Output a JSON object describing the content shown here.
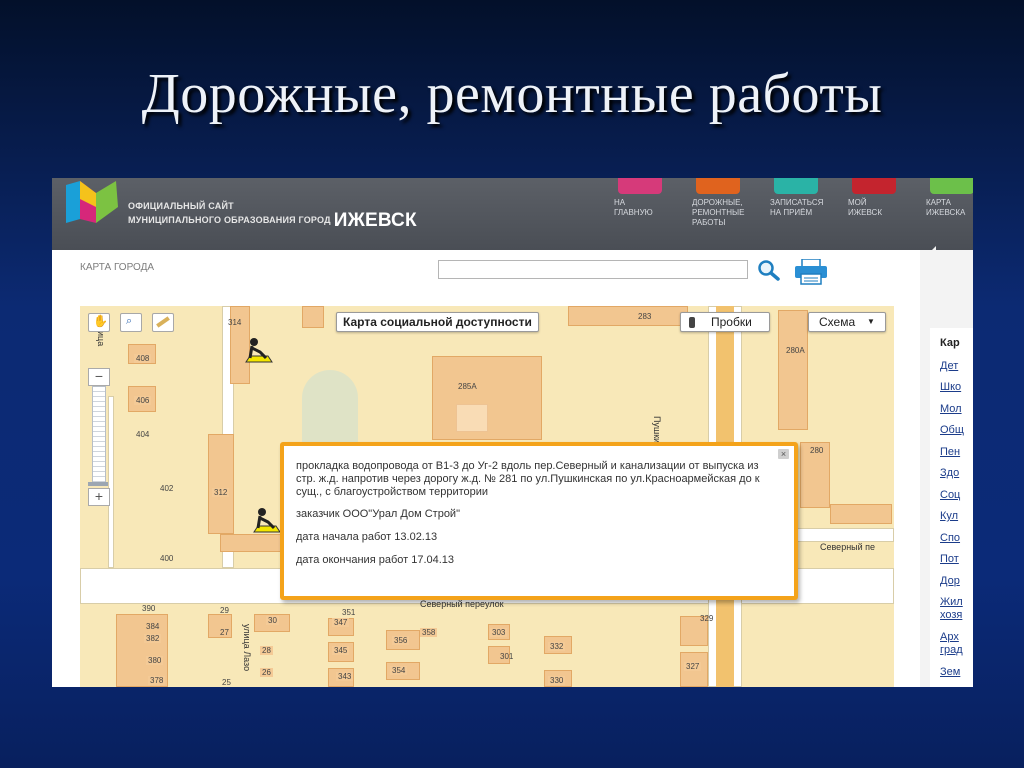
{
  "slide": {
    "title": "Дорожные, ремонтные работы"
  },
  "site": {
    "logo_line1": "ОФИЦИАЛЬНЫЙ САЙТ",
    "logo_line2": "МУНИЦИПАЛЬНОГО ОБРАЗОВАНИЯ ГОРОД",
    "city": "ИЖЕВСК",
    "nav": [
      {
        "line1": "НА",
        "line2": "ГЛАВНУЮ",
        "line3": "",
        "color": "#d63a7a"
      },
      {
        "line1": "ДОРОЖНЫЕ,",
        "line2": "РЕМОНТНЫЕ",
        "line3": "РАБОТЫ",
        "color": "#e0631e"
      },
      {
        "line1": "ЗАПИСАТЬСЯ",
        "line2": "НА ПРИЁМ",
        "line3": "",
        "color": "#2ab3a6"
      },
      {
        "line1": "МОЙ",
        "line2": "ИЖЕВСК",
        "line3": "",
        "color": "#c4242e"
      },
      {
        "line1": "КАРТА",
        "line2": "ИЖЕВСКА",
        "line3": "",
        "color": "#6cc04a"
      }
    ]
  },
  "page": {
    "heading": "КАРТА ГОРОДА",
    "search_value": ""
  },
  "map": {
    "social_button": "Карта социальной доступности",
    "traffic_button": "Пробки",
    "scheme_button": "Схема",
    "scheme_arrow": "▼",
    "zoom_minus": "−",
    "zoom_plus": "+",
    "streets": {
      "pushkinskaya": "Пушкинская ул",
      "severny_per": "Северный переулок",
      "severny_pe": "Северный пе",
      "lazo": "улица Лазо",
      "edge": "рица"
    },
    "house_numbers": [
      "314",
      "283",
      "408",
      "406",
      "404",
      "402",
      "400",
      "285А",
      "280А",
      "280",
      "312",
      "390",
      "384",
      "382",
      "380",
      "378",
      "29",
      "27",
      "25",
      "30",
      "28",
      "26",
      "351",
      "347",
      "345",
      "343",
      "358",
      "356",
      "354",
      "303",
      "301",
      "332",
      "330",
      "327",
      "329"
    ]
  },
  "popup": {
    "description": "прокладка водопровода от В1-3 до Уг-2 вдоль пер.Северный и канализации от выпуска из стр. ж.д. напротив через дорогу ж.д. № 281 по ул.Пушкинская по ул.Красноармейская до к сущ., с благоустройством территории",
    "customer": "заказчик ООО\"Урал Дом Строй\"",
    "start": "дата начала работ 13.02.13",
    "end": "дата окончания работ 17.04.13",
    "close": "×"
  },
  "sidebar": {
    "heading": "Кар",
    "links": [
      "Дет",
      "Шко",
      "Мол",
      "Общ",
      "Пен",
      "Здо",
      "Соц",
      "Кул",
      "Спо",
      "Пот",
      "Дор",
      "Жил",
      "хозя",
      "Арх",
      "град",
      "Зем"
    ]
  }
}
